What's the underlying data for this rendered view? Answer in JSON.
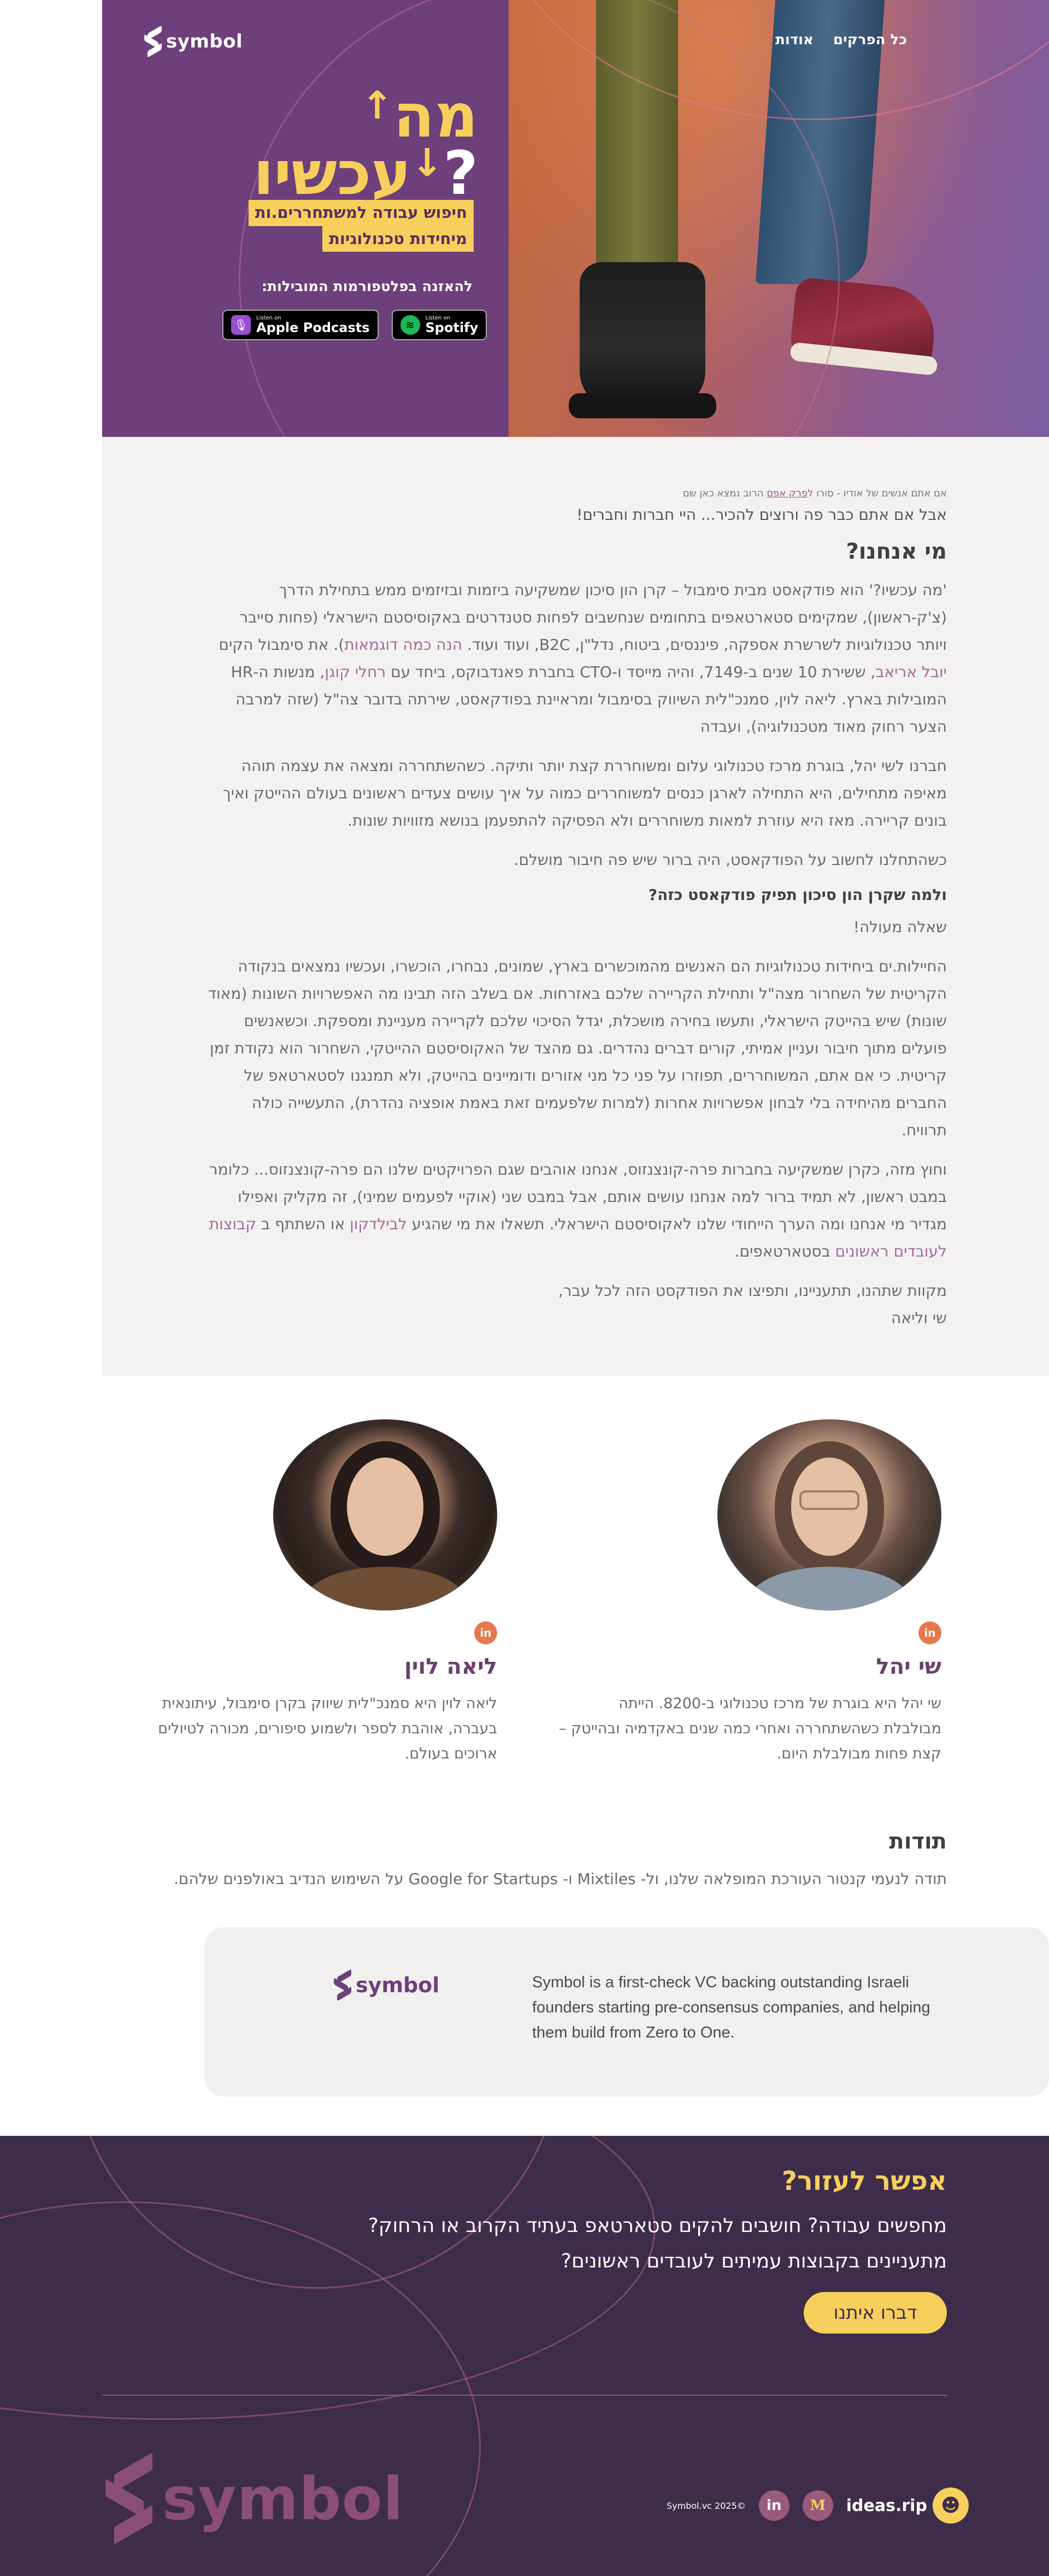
{
  "nav": {
    "logo_text": "symbol",
    "items": [
      "כל הפרקים",
      "אודות"
    ]
  },
  "hero": {
    "title_line1": "מה",
    "title_line2": "עכשיו",
    "title_q": "?",
    "subtitle_line1": "חיפוש עבודה למשתחררים.ות",
    "subtitle_line2": "מיחידות טכנולוגיות",
    "listen_label": "להאזנה בפלטפורמות המובילות:",
    "apple": {
      "small": "Listen on",
      "big": "Apple Podcasts"
    },
    "spotify": {
      "small": "Listen on",
      "big": "Spotify"
    }
  },
  "about": {
    "credit_prefix": "אם אתם אנשים של אודיו - סורו ל",
    "credit_link1": "פרק אפס",
    "credit_mid": " ",
    "credit_suffix": "הרוב נמצא כאן שם",
    "lead": "אבל אם אתם כבר פה ורוצים להכיר... היי חברות וחברים!",
    "heading": "מי אנחנו?",
    "p1": "'מה עכשיו?' הוא פודקאסט מבית סימבול – קרן הון סיכון שמשקיעה ביזמות ובזיזמים ממש בתחילת הדרך (צ'ק-ראשון), שמקימים סטארטאפים בתחומים שנחשבים לפחות סטנדרטים באקוסיסטם הישראלי (פחות סייבר ויותר טכנולוגיות לשרשרת אספקה, פיננסים, ביטוח, נדל\"ן, B2C, ועוד ועוד. ",
    "p1_link": "הנה כמה דוגמאות",
    "p1_b": "). את סימבול הקים ",
    "p1_link2": "יובל אריאב",
    "p1_c": ", ששירת 10 שנים ב-7149, והיה מייסד ו-CTO בחברת פאנדבוקס, ביחד עם ",
    "p1_link3": "רחלי קוגן",
    "p1_d": ", מנשות ה-HR המובילות בארץ. ליאה לוין, סמנכ\"לית השיווק בסימבול ומראיינת בפודקאסט, שירתה בדובר צה\"ל (שזה למרבה הצער רחוק מאוד מטכנולוגיה), ועבדה",
    "p2": "חברנו לשי יהל, בוגרת מרכז טכנולוגי עלום ומשוחררת קצת יותר ותיקה. כשהשתחררה ומצאה את עצמה תוהה מאיפה מתחילים, היא התחילה לארגן כנסים למשוחררים כמוה על איך עושים צעדים ראשונים בעולם ההייטק ואיך בונים קריירה. מאז היא עוזרת למאות משוחררים ולא הפסיקה להתפעמן בנושא מזוויות שונות.",
    "p3": "כשהתחלנו לחשוב על הפודקאסט, היה ברור שיש פה חיבור מושלם.",
    "h4": "ולמה שקרן הון סיכון תפיק פודקאסט כזה?",
    "p4": "שאלה מעולה!",
    "p5": "החיילות.ים ביחידות טכנולוגיות הם האנשים מהמוכשרים בארץ, שמונים, נבחרו, הוכשרו, ועכשיו נמצאים בנקודה הקריטית של השחרור מצה\"ל ותחילת הקריירה שלכם באזרחות. אם בשלב הזה תבינו מה האפשרויות השונות (מאוד שונות) שיש בהייטק הישראלי, ותעשו בחירה מושכלת, יגדל הסיכוי שלכם לקריירה מעניינת ומספקת. וכשאנשים פועלים מתוך חיבור ועניין אמיתי, קורים דברים נהדרים. גם מהצד של האקוסיסטם ההייטקי, השחרור הוא נקודת זמן קריטית. כי אם אתם, המשוחררים, תפוזרו על פני כל מני אזורים ודומיינים בהייטק, ולא תמנגנו לסטארטאפ של החברים מהיחידה בלי לבחון אפשרויות אחרות (למרות שלפעמים זאת באמת אופציה נהדרת), התעשייה כולה תרוויח.",
    "p6_a": "וחוץ מזה, כקרן שמשקיעה בחברות פרה-קונצנזוס, אנחנו אוהבים שגם הפרויקטים שלנו הם פרה-קונצנזוס... כלומר במבט ראשון, לא תמיד ברור למה אנחנו עושים אותם, אבל במבט שני (אוקיי לפעמים שמיני), זה מקליק ואפילו מגדיר מי אנחנו ומה הערך הייחודי שלנו לאקוסיסטם הישראלי. תשאלו את מי שהגיע ",
    "p6_link1": "לבילדקון",
    "p6_b": " או השתתף ב ",
    "p6_link2": "קבוצות לעובדים ראשונים",
    "p6_c": " בסטארטאפים.",
    "p7": "מקוות שתהנו, תתעניינו, ותפיצו את הפודקסט הזה לכל עבר,",
    "sign": "שי וליאה"
  },
  "hosts": [
    {
      "name": "שי יהל",
      "bio": "שי יהל היא בוגרת של מרכז טכנולוגי ב-8200. הייתה מבולבלת כשהשתחררה ואחרי כמה שנים באקדמיה ובהייטק – קצת פחות מבולבלת היום."
    },
    {
      "name": "ליאה לוין",
      "bio": "ליאה לוין היא סמנכ\"לית שיווק בקרן סימבול, עיתונאית בעברה, אוהבת לספר ולשמוע סיפורים, מכורה לטיולים ארוכים בעולם."
    }
  ],
  "thanks": {
    "title": "תודות",
    "text": "תודה לנעמי קנטור העורכת המופלאה שלנו, ול- Mixtiles ו- Google for Startups על השימוש הנדיב באולפנים שלהם."
  },
  "symbol_box": {
    "logo": "symbol",
    "text": "Symbol is a first-check VC backing outstanding Israeli founders starting pre-consensus companies, and helping them build from Zero to One."
  },
  "footer": {
    "help_title": "אפשר לעזור?",
    "line1": "מחפשים עבודה? חושבים להקים סטארטאפ בעתיד הקרוב או הרחוק?",
    "line2": "מתעניינים בקבוצות עמיתים לעובדים ראשונים?",
    "button": "דברו איתנו",
    "big_logo": "symbol",
    "ideas": "ideas.rip",
    "medium": "M",
    "linkedin": "in",
    "copyright": "Symbol.vc 2025©"
  },
  "colors": {
    "purple": "#6d3f7b",
    "yellow": "#f7cf5c",
    "footer_bg": "#3e2d4a",
    "orange": "#e47a4b"
  }
}
